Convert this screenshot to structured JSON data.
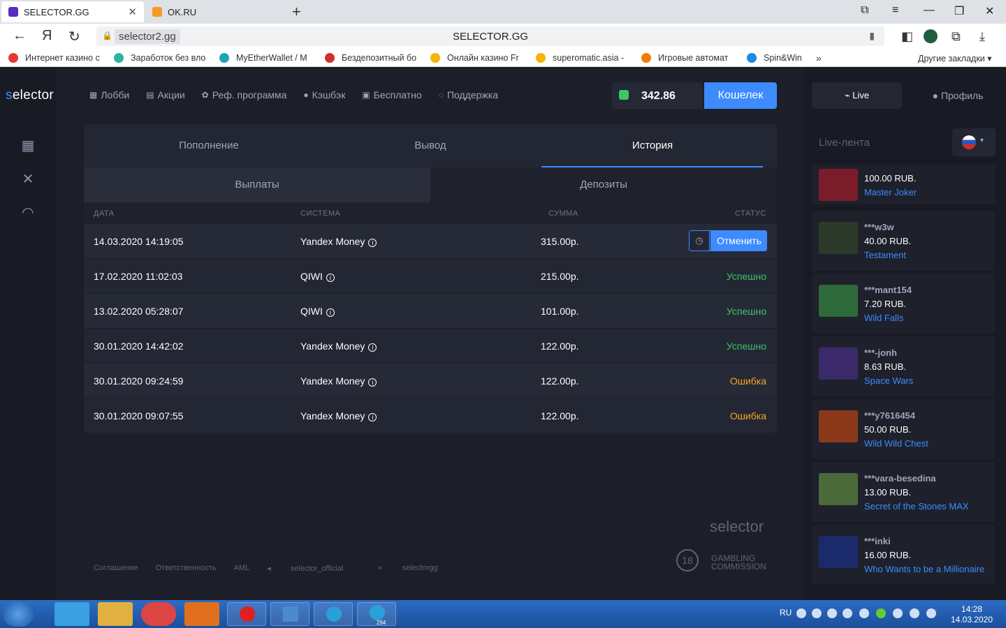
{
  "browser": {
    "tabs": [
      {
        "label": "SELECTOR.GG",
        "favicon_color": "#5b2dbf"
      },
      {
        "label": "OK.RU",
        "favicon_color": "#f59a23"
      }
    ],
    "omnibox": {
      "domain": "selector2.gg",
      "title": "SELECTOR.GG"
    },
    "bookmarks": [
      {
        "label": "Интернет казино с",
        "color": "#e53935"
      },
      {
        "label": "Заработок без вло",
        "color": "#2bb3a3"
      },
      {
        "label": "MyEtherWallet / M",
        "color": "#1aa6b7"
      },
      {
        "label": "Бездепозитный бо",
        "color": "#d32f2f"
      },
      {
        "label": "Онлайн казино Fr",
        "color": "#f5b400"
      },
      {
        "label": "superomatic.asia -",
        "color": "#f5b400"
      },
      {
        "label": "Игровые автомат",
        "color": "#f57c00"
      },
      {
        "label": "Spin&Win",
        "color": "#1e88e5"
      }
    ],
    "bookmarks_more": "»",
    "bookmarks_other": "Другие закладки"
  },
  "site": {
    "logo_prefix": "s",
    "logo_rest": "elector",
    "nav": [
      {
        "label": "Лобби",
        "icon": "▦"
      },
      {
        "label": "Акции",
        "icon": "▤"
      },
      {
        "label": "Реф. программа",
        "icon": "✿"
      },
      {
        "label": "Кэшбэк",
        "icon": "●"
      },
      {
        "label": "Бесплатно",
        "icon": "▣"
      },
      {
        "label": "Поддержка",
        "icon": "◌"
      }
    ],
    "balance": "342.86",
    "wallet_label": "Кошелек",
    "main_tabs": [
      "Пополнение",
      "Вывод",
      "История"
    ],
    "sub_tabs": [
      "Выплаты",
      "Депозиты"
    ],
    "columns": {
      "date": "ДАТА",
      "system": "СИСТЕМА",
      "amount": "СУММА",
      "status": "СТАТУС"
    },
    "cancel_label": "Отменить",
    "rows": [
      {
        "date": "14.03.2020 14:19:05",
        "system": "Yandex Money",
        "amount": "315.00р.",
        "status": "",
        "kind": "cancel"
      },
      {
        "date": "17.02.2020 11:02:03",
        "system": "QIWI",
        "amount": "215.00р.",
        "status": "Успешно",
        "kind": "ok"
      },
      {
        "date": "13.02.2020 05:28:07",
        "system": "QIWI",
        "amount": "101.00р.",
        "status": "Успешно",
        "kind": "ok"
      },
      {
        "date": "30.01.2020 14:42:02",
        "system": "Yandex Money",
        "amount": "122.00р.",
        "status": "Успешно",
        "kind": "ok"
      },
      {
        "date": "30.01.2020 09:24:59",
        "system": "Yandex Money",
        "amount": "122.00р.",
        "status": "Ошибка",
        "kind": "err"
      },
      {
        "date": "30.01.2020 09:07:55",
        "system": "Yandex Money",
        "amount": "122.00р.",
        "status": "Ошибка",
        "kind": "err"
      }
    ],
    "footer_links": [
      "Соглашение",
      "Ответственность",
      "AML",
      "selector_official",
      "selectorgg"
    ],
    "footer_logo": "selector",
    "age_badge": "18",
    "gambling_line1": "GAMBLING",
    "gambling_line2": "COMMISSION"
  },
  "live": {
    "live_label": "Live",
    "profile_label": "Профиль",
    "feed_title": "Live-лента",
    "feed": [
      {
        "user": "",
        "amount": "100.00 RUB.",
        "game": "Master Joker",
        "thumb": "#7a1c2a"
      },
      {
        "user": "***w3w",
        "amount": "40.00 RUB.",
        "game": "Testament",
        "thumb": "#2c3a2a"
      },
      {
        "user": "***mant154",
        "amount": "7.20 RUB.",
        "game": "Wild Falls",
        "thumb": "#2f6a3a"
      },
      {
        "user": "***-jonh",
        "amount": "8.63 RUB.",
        "game": "Space Wars",
        "thumb": "#3a2a6a"
      },
      {
        "user": "***y7616454",
        "amount": "50.00 RUB.",
        "game": "Wild Wild Chest",
        "thumb": "#8a3a1a"
      },
      {
        "user": "***vara-besedina",
        "amount": "13.00 RUB.",
        "game": "Secret of the Stones MAX",
        "thumb": "#4a6a3a"
      },
      {
        "user": "***inki",
        "amount": "16.00 RUB.",
        "game": "Who Wants to be a Millionaire",
        "thumb": "#1a2a6a"
      }
    ]
  },
  "taskbar": {
    "lang": "RU",
    "time": "14:28",
    "date": "14.03.2020",
    "apps": [
      {
        "name": "ie",
        "color": "#3aa0e0"
      },
      {
        "name": "explorer",
        "color": "#e0b040"
      },
      {
        "name": "chrome",
        "color": "#d44"
      },
      {
        "name": "media",
        "color": "#e07020"
      },
      {
        "name": "yandex",
        "color": "#e02020"
      },
      {
        "name": "control",
        "color": "#4a8ad0"
      },
      {
        "name": "telegram",
        "color": "#2aa0d8"
      },
      {
        "name": "telegram2",
        "color": "#2aa0d8"
      }
    ],
    "telegram_badge": "294"
  }
}
